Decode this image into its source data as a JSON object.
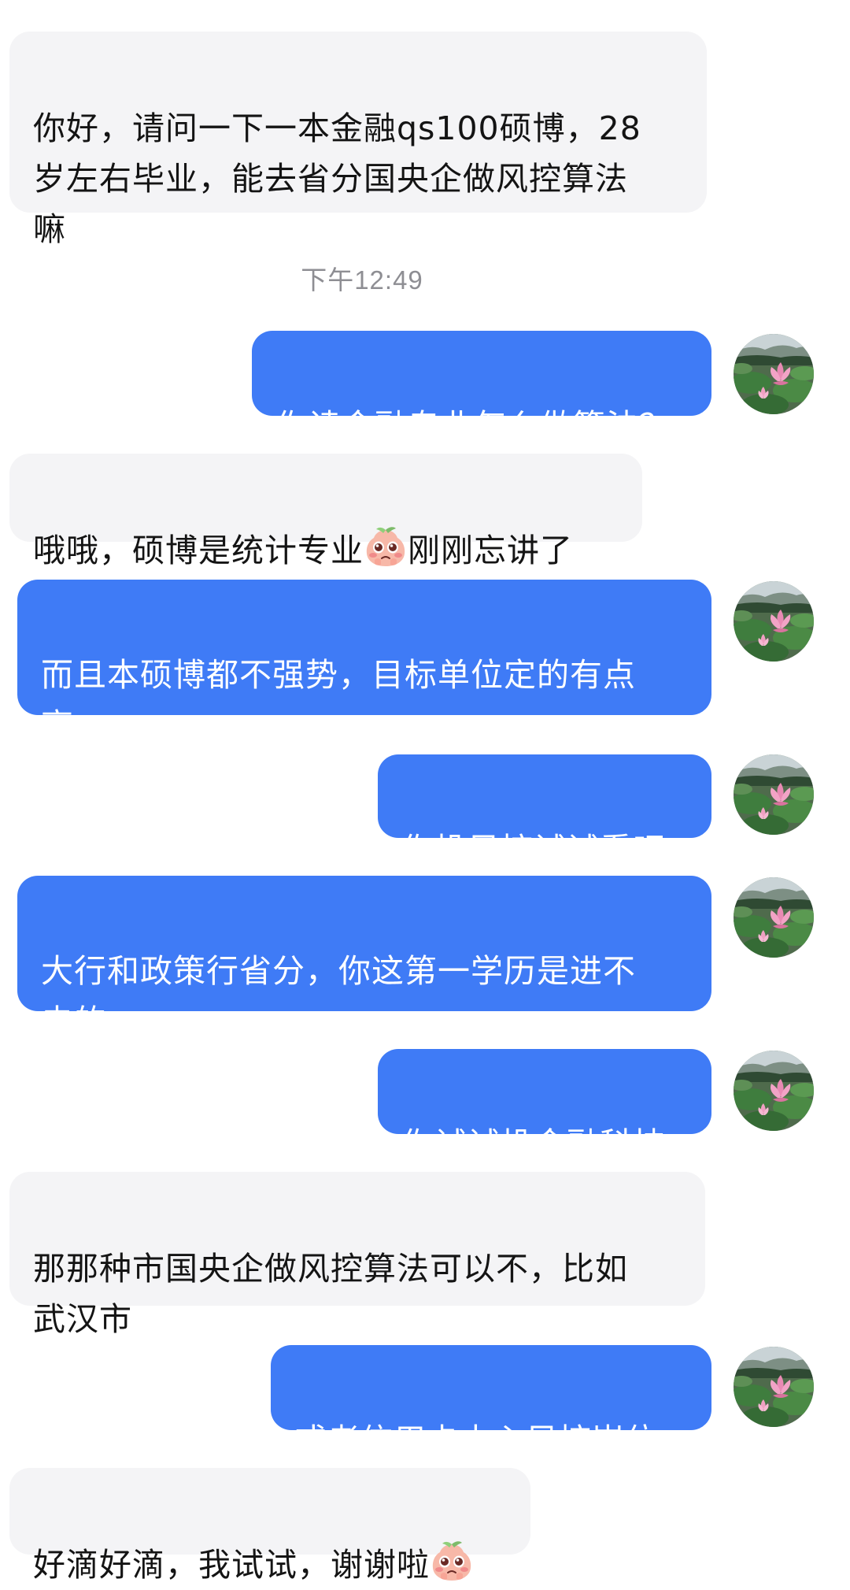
{
  "timestamp": "下午12:49",
  "messages": [
    {
      "side": "in",
      "lines": [
        "你好，请问一下一本金融qs100硕博，28",
        "岁左右毕业，能去省分国央企做风控算法",
        "嘛"
      ]
    },
    {
      "side": "out",
      "lines": [
        "你读金融专业怎么做算法？"
      ]
    },
    {
      "side": "in",
      "before_emoji": "哦哦，硕博是统计专业",
      "after_emoji": "刚刚忘讲了"
    },
    {
      "side": "out",
      "lines": [
        "而且本硕博都不强势，目标单位定的有点",
        "高"
      ]
    },
    {
      "side": "out",
      "lines": [
        "你投风控试试看吧"
      ]
    },
    {
      "side": "out",
      "lines": [
        "大行和政策行省分，你这第一学历是进不",
        "去的"
      ]
    },
    {
      "side": "out",
      "lines": [
        "你试试投金融科技"
      ]
    },
    {
      "side": "in",
      "lines": [
        "那那种市国央企做风控算法可以不，比如",
        "武汉市"
      ]
    },
    {
      "side": "out",
      "lines": [
        "或者信用卡中心风控岗位"
      ]
    },
    {
      "side": "in",
      "before_emoji": "好滴好滴，我试试，谢谢啦"
    }
  ],
  "colors": {
    "incoming_bubble": "#f4f4f6",
    "outgoing_bubble": "#3f7bf6",
    "timestamp_text": "#8e8e93"
  },
  "icons": {
    "avatar": "lotus-pond-avatar",
    "emoji": "blushing-peach-emoji"
  }
}
